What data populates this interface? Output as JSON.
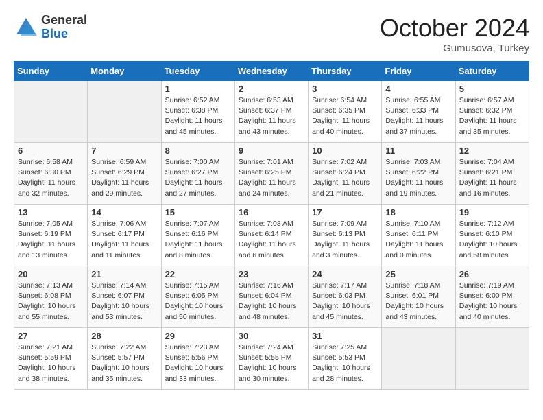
{
  "logo": {
    "general": "General",
    "blue": "Blue"
  },
  "title": "October 2024",
  "subtitle": "Gumusova, Turkey",
  "days_of_week": [
    "Sunday",
    "Monday",
    "Tuesday",
    "Wednesday",
    "Thursday",
    "Friday",
    "Saturday"
  ],
  "weeks": [
    [
      {
        "day": "",
        "info": ""
      },
      {
        "day": "",
        "info": ""
      },
      {
        "day": "1",
        "info": "Sunrise: 6:52 AM\nSunset: 6:38 PM\nDaylight: 11 hours and 45 minutes."
      },
      {
        "day": "2",
        "info": "Sunrise: 6:53 AM\nSunset: 6:37 PM\nDaylight: 11 hours and 43 minutes."
      },
      {
        "day": "3",
        "info": "Sunrise: 6:54 AM\nSunset: 6:35 PM\nDaylight: 11 hours and 40 minutes."
      },
      {
        "day": "4",
        "info": "Sunrise: 6:55 AM\nSunset: 6:33 PM\nDaylight: 11 hours and 37 minutes."
      },
      {
        "day": "5",
        "info": "Sunrise: 6:57 AM\nSunset: 6:32 PM\nDaylight: 11 hours and 35 minutes."
      }
    ],
    [
      {
        "day": "6",
        "info": "Sunrise: 6:58 AM\nSunset: 6:30 PM\nDaylight: 11 hours and 32 minutes."
      },
      {
        "day": "7",
        "info": "Sunrise: 6:59 AM\nSunset: 6:29 PM\nDaylight: 11 hours and 29 minutes."
      },
      {
        "day": "8",
        "info": "Sunrise: 7:00 AM\nSunset: 6:27 PM\nDaylight: 11 hours and 27 minutes."
      },
      {
        "day": "9",
        "info": "Sunrise: 7:01 AM\nSunset: 6:25 PM\nDaylight: 11 hours and 24 minutes."
      },
      {
        "day": "10",
        "info": "Sunrise: 7:02 AM\nSunset: 6:24 PM\nDaylight: 11 hours and 21 minutes."
      },
      {
        "day": "11",
        "info": "Sunrise: 7:03 AM\nSunset: 6:22 PM\nDaylight: 11 hours and 19 minutes."
      },
      {
        "day": "12",
        "info": "Sunrise: 7:04 AM\nSunset: 6:21 PM\nDaylight: 11 hours and 16 minutes."
      }
    ],
    [
      {
        "day": "13",
        "info": "Sunrise: 7:05 AM\nSunset: 6:19 PM\nDaylight: 11 hours and 13 minutes."
      },
      {
        "day": "14",
        "info": "Sunrise: 7:06 AM\nSunset: 6:17 PM\nDaylight: 11 hours and 11 minutes."
      },
      {
        "day": "15",
        "info": "Sunrise: 7:07 AM\nSunset: 6:16 PM\nDaylight: 11 hours and 8 minutes."
      },
      {
        "day": "16",
        "info": "Sunrise: 7:08 AM\nSunset: 6:14 PM\nDaylight: 11 hours and 6 minutes."
      },
      {
        "day": "17",
        "info": "Sunrise: 7:09 AM\nSunset: 6:13 PM\nDaylight: 11 hours and 3 minutes."
      },
      {
        "day": "18",
        "info": "Sunrise: 7:10 AM\nSunset: 6:11 PM\nDaylight: 11 hours and 0 minutes."
      },
      {
        "day": "19",
        "info": "Sunrise: 7:12 AM\nSunset: 6:10 PM\nDaylight: 10 hours and 58 minutes."
      }
    ],
    [
      {
        "day": "20",
        "info": "Sunrise: 7:13 AM\nSunset: 6:08 PM\nDaylight: 10 hours and 55 minutes."
      },
      {
        "day": "21",
        "info": "Sunrise: 7:14 AM\nSunset: 6:07 PM\nDaylight: 10 hours and 53 minutes."
      },
      {
        "day": "22",
        "info": "Sunrise: 7:15 AM\nSunset: 6:05 PM\nDaylight: 10 hours and 50 minutes."
      },
      {
        "day": "23",
        "info": "Sunrise: 7:16 AM\nSunset: 6:04 PM\nDaylight: 10 hours and 48 minutes."
      },
      {
        "day": "24",
        "info": "Sunrise: 7:17 AM\nSunset: 6:03 PM\nDaylight: 10 hours and 45 minutes."
      },
      {
        "day": "25",
        "info": "Sunrise: 7:18 AM\nSunset: 6:01 PM\nDaylight: 10 hours and 43 minutes."
      },
      {
        "day": "26",
        "info": "Sunrise: 7:19 AM\nSunset: 6:00 PM\nDaylight: 10 hours and 40 minutes."
      }
    ],
    [
      {
        "day": "27",
        "info": "Sunrise: 7:21 AM\nSunset: 5:59 PM\nDaylight: 10 hours and 38 minutes."
      },
      {
        "day": "28",
        "info": "Sunrise: 7:22 AM\nSunset: 5:57 PM\nDaylight: 10 hours and 35 minutes."
      },
      {
        "day": "29",
        "info": "Sunrise: 7:23 AM\nSunset: 5:56 PM\nDaylight: 10 hours and 33 minutes."
      },
      {
        "day": "30",
        "info": "Sunrise: 7:24 AM\nSunset: 5:55 PM\nDaylight: 10 hours and 30 minutes."
      },
      {
        "day": "31",
        "info": "Sunrise: 7:25 AM\nSunset: 5:53 PM\nDaylight: 10 hours and 28 minutes."
      },
      {
        "day": "",
        "info": ""
      },
      {
        "day": "",
        "info": ""
      }
    ]
  ]
}
